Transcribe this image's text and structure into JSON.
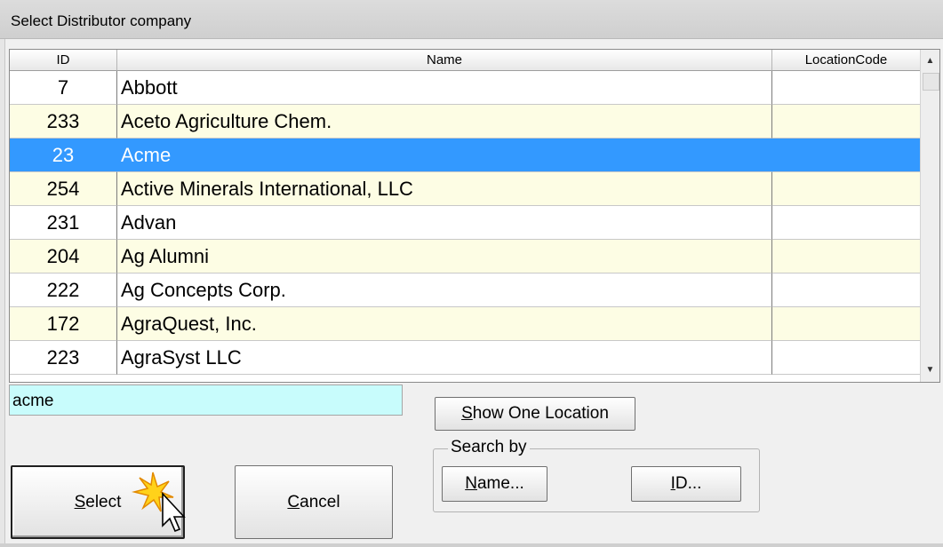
{
  "window": {
    "title": "Select Distributor company"
  },
  "grid": {
    "columns": [
      "ID",
      "Name",
      "LocationCode"
    ],
    "rows": [
      {
        "id": "7",
        "name": "Abbott",
        "location": ""
      },
      {
        "id": "233",
        "name": "Aceto Agriculture Chem.",
        "location": ""
      },
      {
        "id": "23",
        "name": "Acme",
        "location": ""
      },
      {
        "id": "254",
        "name": "Active Minerals International, LLC",
        "location": ""
      },
      {
        "id": "231",
        "name": "Advan",
        "location": ""
      },
      {
        "id": "204",
        "name": "Ag Alumni",
        "location": ""
      },
      {
        "id": "222",
        "name": "Ag Concepts Corp.",
        "location": ""
      },
      {
        "id": "172",
        "name": "AgraQuest, Inc.",
        "location": ""
      },
      {
        "id": "223",
        "name": "AgraSyst LLC",
        "location": ""
      }
    ],
    "selected_index": 2
  },
  "search": {
    "value": "acme"
  },
  "buttons": {
    "show_one_location": {
      "mnemonic": "S",
      "rest": "how One Location"
    },
    "select": {
      "mnemonic": "S",
      "rest": "elect"
    },
    "cancel": {
      "mnemonic": "C",
      "rest": "ancel"
    },
    "name": {
      "mnemonic": "N",
      "rest": "ame..."
    },
    "id": {
      "mnemonic": "I",
      "rest": "D..."
    }
  },
  "search_by": {
    "legend": "Search by"
  },
  "colors": {
    "selection": "#3399ff",
    "alt_row": "#fdfde4",
    "search_bg": "#c8fcfc"
  },
  "icons": [
    "sort-up-arrow-icon",
    "scroll-down-arrow-icon",
    "mouse-pointer-click-icon"
  ]
}
